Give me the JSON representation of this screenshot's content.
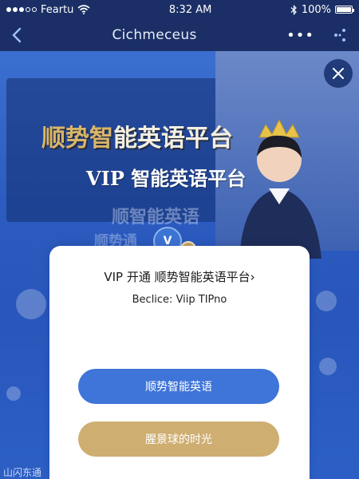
{
  "status_bar": {
    "carrier": "Feartu",
    "time": "8:32 AM",
    "battery": "100%",
    "wifi_icon": "wifi-icon",
    "bluetooth_icon": "bluetooth-icon"
  },
  "nav": {
    "title": "Cichmeceus",
    "back_icon": "back-chevron-icon",
    "more_icon": "more-dots-icon",
    "share_icon": "share-icon"
  },
  "banner": {
    "headline_gold": "顺势智",
    "headline_rest": "能英语平台",
    "subheadline": "VIP 智能英语平台",
    "ghost_line_1": "顺智能英语",
    "ghost_line_2": "顺势通",
    "badge_text": "V",
    "bottom_text": "山闪东通"
  },
  "card": {
    "title": "VIP 开通  顺势智能英语平台›",
    "subtitle": "Beclice: Viip TIPno",
    "primary_button": "顺势智能英语",
    "secondary_button": "腥景球的时光"
  },
  "colors": {
    "top_bar": "#1b2f66",
    "banner_blue": "#2c5cc0",
    "primary_button": "#3f74d8",
    "secondary_button": "#cfae72",
    "gold_text": "#d8b56a"
  }
}
